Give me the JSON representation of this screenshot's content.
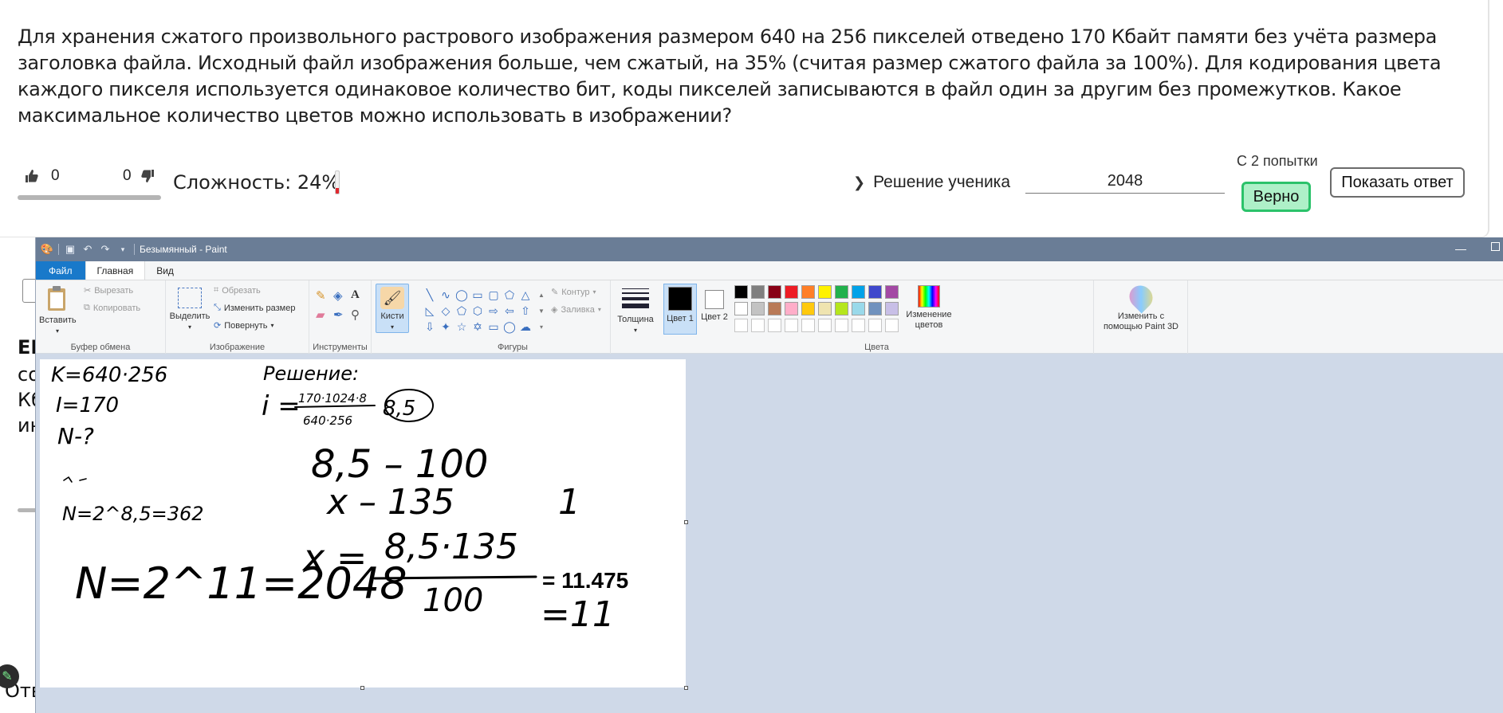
{
  "question": {
    "text": "Для хранения сжатого произвольного растрового изображения размером 640 на 256 пикселей отведено 170 Кбайт памяти без учёта размера заголовка файла. Исходный файл изображения больше, чем сжатый, на 35% (считая размер сжатого файла за 100%). Для кодирования цвета каждого пикселя используется одинаковое количество бит, коды пикселей записываются в файл один за другим без промежутков. Какое максимальное количество цветов можно использовать в изображении?"
  },
  "feedback": {
    "likes": "0",
    "dislikes": "0",
    "difficulty_label": "Сложность: 24%",
    "difficulty_level": 0.24,
    "difficulty_color": "#e0282e"
  },
  "solution": {
    "toggle_label": "Решение ученика",
    "answer_value": "2048",
    "attempts": "С 2 попытки",
    "verdict": "Верно",
    "show_answer": "Показать ответ"
  },
  "behind": {
    "peek1": "ЕГ",
    "peek2": "со",
    "peek3": "Кб",
    "peek4": "ин",
    "peek5": "Отв"
  },
  "paint": {
    "window_title": "Безымянный - Paint",
    "menu": {
      "file": "Файл",
      "home": "Главная",
      "view": "Вид"
    },
    "clipboard": {
      "paste": "Вставить",
      "cut": "Вырезать",
      "copy": "Копировать",
      "label": "Буфер обмена"
    },
    "image": {
      "select": "Выделить",
      "crop": "Обрезать",
      "resize": "Изменить размер",
      "rotate": "Повернуть",
      "label": "Изображение"
    },
    "tools": {
      "label": "Инструменты"
    },
    "brushes": {
      "label": "Кисти"
    },
    "shapes": {
      "outline": "Контур",
      "fill": "Заливка",
      "label": "Фигуры"
    },
    "size": {
      "label": "Толщина"
    },
    "colors": {
      "color1": "Цвет 1",
      "color2": "Цвет 2",
      "edit": "Изменение цветов",
      "paint3d": "Изменить с помощью Paint 3D",
      "label": "Цвета",
      "palette": [
        "#000000",
        "#7f7f7f",
        "#880015",
        "#ed1c24",
        "#ff7f27",
        "#fff200",
        "#22b14c",
        "#00a2e8",
        "#3f48cc",
        "#a349a4",
        "#ffffff",
        "#c3c3c3",
        "#b97a57",
        "#ffaec9",
        "#ffc90e",
        "#efe4b0",
        "#b5e61d",
        "#99d9ea",
        "#7092be",
        "#c8bfe7"
      ]
    },
    "canvas_text": {
      "result": "= 11.475",
      "k_eq": "K=640·256",
      "i_eq": "I=170",
      "n_q": "N-?",
      "resh": "Решение:",
      "frac_top": "170·1024·8",
      "frac_bot": "640·256",
      "i_val": "8,5",
      "line1": "8,5 – 100",
      "line2": "x – 135",
      "one": "1",
      "n_eq": "N=2^8,5=362",
      "x_eq": "x =",
      "x_num": "8,5·135",
      "x_den": "100",
      "n_final": "N=2^11=2048",
      "eq11": "=11"
    }
  }
}
